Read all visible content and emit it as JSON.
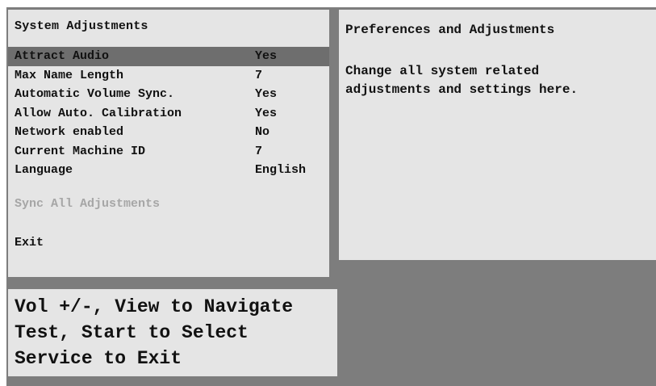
{
  "menu": {
    "title": "System Adjustments",
    "items": [
      {
        "label": "Attract Audio",
        "value": "Yes",
        "selected": true
      },
      {
        "label": "Max Name Length",
        "value": "7"
      },
      {
        "label": "Automatic Volume Sync.",
        "value": "Yes"
      },
      {
        "label": "Allow Auto. Calibration",
        "value": "Yes"
      },
      {
        "label": "Network enabled",
        "value": "No"
      },
      {
        "label": "Current Machine ID",
        "value": "7"
      },
      {
        "label": "Language",
        "value": "English"
      }
    ],
    "sync_action": "Sync All Adjustments",
    "exit_action": "Exit"
  },
  "info": {
    "title": "Preferences and Adjustments",
    "line1": "Change all system related",
    "line2": "adjustments and settings here."
  },
  "help": {
    "line1": "Vol +/-, View to Navigate",
    "line2": "Test, Start to Select",
    "line3": "Service to Exit"
  },
  "colors": {
    "background": "#7d7d7d",
    "panel": "#e5e5e5",
    "highlight": "#6e6e6e",
    "disabled_text": "#a6a6a6"
  }
}
